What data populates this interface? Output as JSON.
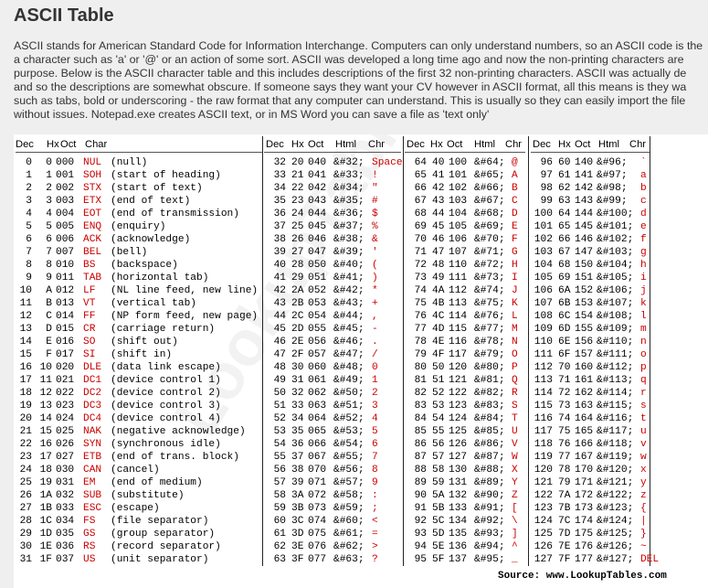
{
  "title": "ASCII Table",
  "intro_lines": [
    "ASCII stands for American Standard Code for Information Interchange. Computers can only understand numbers, so an ASCII code is the",
    "a character such as 'a' or '@' or an action of some sort. ASCII was developed a long time ago and now the non-printing characters are",
    "purpose. Below is the ASCII character table and this includes descriptions of the first 32 non-printing characters. ASCII was actually de",
    "and so the descriptions are somewhat obscure. If someone says they want your CV however in ASCII format, all this means is they wa",
    "such as tabs, bold or underscoring - the raw format that any computer can understand. This is usually so they can easily import the file",
    "without issues. Notepad.exe creates ASCII text, or in MS Word you can save a file as 'text only'"
  ],
  "headers": {
    "block1": [
      "Dec",
      "Hx",
      "Oct",
      "Char"
    ],
    "block2": [
      "Dec",
      "Hx",
      "Oct",
      "Html",
      "Chr"
    ],
    "block3": [
      "Dec",
      "Hx",
      "Oct",
      "Html",
      "Chr"
    ],
    "block4": [
      "Dec",
      "Hx",
      "Oct",
      "Html",
      "Chr"
    ]
  },
  "control_rows": [
    [
      "0",
      "0",
      "000",
      "NUL",
      "(null)"
    ],
    [
      "1",
      "1",
      "001",
      "SOH",
      "(start of heading)"
    ],
    [
      "2",
      "2",
      "002",
      "STX",
      "(start of text)"
    ],
    [
      "3",
      "3",
      "003",
      "ETX",
      "(end of text)"
    ],
    [
      "4",
      "4",
      "004",
      "EOT",
      "(end of transmission)"
    ],
    [
      "5",
      "5",
      "005",
      "ENQ",
      "(enquiry)"
    ],
    [
      "6",
      "6",
      "006",
      "ACK",
      "(acknowledge)"
    ],
    [
      "7",
      "7",
      "007",
      "BEL",
      "(bell)"
    ],
    [
      "8",
      "8",
      "010",
      "BS",
      "(backspace)"
    ],
    [
      "9",
      "9",
      "011",
      "TAB",
      "(horizontal tab)"
    ],
    [
      "10",
      "A",
      "012",
      "LF",
      "(NL line feed, new line)"
    ],
    [
      "11",
      "B",
      "013",
      "VT",
      "(vertical tab)"
    ],
    [
      "12",
      "C",
      "014",
      "FF",
      "(NP form feed, new page)"
    ],
    [
      "13",
      "D",
      "015",
      "CR",
      "(carriage return)"
    ],
    [
      "14",
      "E",
      "016",
      "SO",
      "(shift out)"
    ],
    [
      "15",
      "F",
      "017",
      "SI",
      "(shift in)"
    ],
    [
      "16",
      "10",
      "020",
      "DLE",
      "(data link escape)"
    ],
    [
      "17",
      "11",
      "021",
      "DC1",
      "(device control 1)"
    ],
    [
      "18",
      "12",
      "022",
      "DC2",
      "(device control 2)"
    ],
    [
      "19",
      "13",
      "023",
      "DC3",
      "(device control 3)"
    ],
    [
      "20",
      "14",
      "024",
      "DC4",
      "(device control 4)"
    ],
    [
      "21",
      "15",
      "025",
      "NAK",
      "(negative acknowledge)"
    ],
    [
      "22",
      "16",
      "026",
      "SYN",
      "(synchronous idle)"
    ],
    [
      "23",
      "17",
      "027",
      "ETB",
      "(end of trans. block)"
    ],
    [
      "24",
      "18",
      "030",
      "CAN",
      "(cancel)"
    ],
    [
      "25",
      "19",
      "031",
      "EM",
      "(end of medium)"
    ],
    [
      "26",
      "1A",
      "032",
      "SUB",
      "(substitute)"
    ],
    [
      "27",
      "1B",
      "033",
      "ESC",
      "(escape)"
    ],
    [
      "28",
      "1C",
      "034",
      "FS",
      "(file separator)"
    ],
    [
      "29",
      "1D",
      "035",
      "GS",
      "(group separator)"
    ],
    [
      "30",
      "1E",
      "036",
      "RS",
      "(record separator)"
    ],
    [
      "31",
      "1F",
      "037",
      "US",
      "(unit separator)"
    ]
  ],
  "printable_blocks": [
    [
      [
        "32",
        "20",
        "040",
        "&#32;",
        "Space"
      ],
      [
        "33",
        "21",
        "041",
        "&#33;",
        "!"
      ],
      [
        "34",
        "22",
        "042",
        "&#34;",
        "\""
      ],
      [
        "35",
        "23",
        "043",
        "&#35;",
        "#"
      ],
      [
        "36",
        "24",
        "044",
        "&#36;",
        "$"
      ],
      [
        "37",
        "25",
        "045",
        "&#37;",
        "%"
      ],
      [
        "38",
        "26",
        "046",
        "&#38;",
        "&"
      ],
      [
        "39",
        "27",
        "047",
        "&#39;",
        "'"
      ],
      [
        "40",
        "28",
        "050",
        "&#40;",
        "("
      ],
      [
        "41",
        "29",
        "051",
        "&#41;",
        ")"
      ],
      [
        "42",
        "2A",
        "052",
        "&#42;",
        "*"
      ],
      [
        "43",
        "2B",
        "053",
        "&#43;",
        "+"
      ],
      [
        "44",
        "2C",
        "054",
        "&#44;",
        ","
      ],
      [
        "45",
        "2D",
        "055",
        "&#45;",
        "-"
      ],
      [
        "46",
        "2E",
        "056",
        "&#46;",
        "."
      ],
      [
        "47",
        "2F",
        "057",
        "&#47;",
        "/"
      ],
      [
        "48",
        "30",
        "060",
        "&#48;",
        "0"
      ],
      [
        "49",
        "31",
        "061",
        "&#49;",
        "1"
      ],
      [
        "50",
        "32",
        "062",
        "&#50;",
        "2"
      ],
      [
        "51",
        "33",
        "063",
        "&#51;",
        "3"
      ],
      [
        "52",
        "34",
        "064",
        "&#52;",
        "4"
      ],
      [
        "53",
        "35",
        "065",
        "&#53;",
        "5"
      ],
      [
        "54",
        "36",
        "066",
        "&#54;",
        "6"
      ],
      [
        "55",
        "37",
        "067",
        "&#55;",
        "7"
      ],
      [
        "56",
        "38",
        "070",
        "&#56;",
        "8"
      ],
      [
        "57",
        "39",
        "071",
        "&#57;",
        "9"
      ],
      [
        "58",
        "3A",
        "072",
        "&#58;",
        ":"
      ],
      [
        "59",
        "3B",
        "073",
        "&#59;",
        ";"
      ],
      [
        "60",
        "3C",
        "074",
        "&#60;",
        "<"
      ],
      [
        "61",
        "3D",
        "075",
        "&#61;",
        "="
      ],
      [
        "62",
        "3E",
        "076",
        "&#62;",
        ">"
      ],
      [
        "63",
        "3F",
        "077",
        "&#63;",
        "?"
      ]
    ],
    [
      [
        "64",
        "40",
        "100",
        "&#64;",
        "@"
      ],
      [
        "65",
        "41",
        "101",
        "&#65;",
        "A"
      ],
      [
        "66",
        "42",
        "102",
        "&#66;",
        "B"
      ],
      [
        "67",
        "43",
        "103",
        "&#67;",
        "C"
      ],
      [
        "68",
        "44",
        "104",
        "&#68;",
        "D"
      ],
      [
        "69",
        "45",
        "105",
        "&#69;",
        "E"
      ],
      [
        "70",
        "46",
        "106",
        "&#70;",
        "F"
      ],
      [
        "71",
        "47",
        "107",
        "&#71;",
        "G"
      ],
      [
        "72",
        "48",
        "110",
        "&#72;",
        "H"
      ],
      [
        "73",
        "49",
        "111",
        "&#73;",
        "I"
      ],
      [
        "74",
        "4A",
        "112",
        "&#74;",
        "J"
      ],
      [
        "75",
        "4B",
        "113",
        "&#75;",
        "K"
      ],
      [
        "76",
        "4C",
        "114",
        "&#76;",
        "L"
      ],
      [
        "77",
        "4D",
        "115",
        "&#77;",
        "M"
      ],
      [
        "78",
        "4E",
        "116",
        "&#78;",
        "N"
      ],
      [
        "79",
        "4F",
        "117",
        "&#79;",
        "O"
      ],
      [
        "80",
        "50",
        "120",
        "&#80;",
        "P"
      ],
      [
        "81",
        "51",
        "121",
        "&#81;",
        "Q"
      ],
      [
        "82",
        "52",
        "122",
        "&#82;",
        "R"
      ],
      [
        "83",
        "53",
        "123",
        "&#83;",
        "S"
      ],
      [
        "84",
        "54",
        "124",
        "&#84;",
        "T"
      ],
      [
        "85",
        "55",
        "125",
        "&#85;",
        "U"
      ],
      [
        "86",
        "56",
        "126",
        "&#86;",
        "V"
      ],
      [
        "87",
        "57",
        "127",
        "&#87;",
        "W"
      ],
      [
        "88",
        "58",
        "130",
        "&#88;",
        "X"
      ],
      [
        "89",
        "59",
        "131",
        "&#89;",
        "Y"
      ],
      [
        "90",
        "5A",
        "132",
        "&#90;",
        "Z"
      ],
      [
        "91",
        "5B",
        "133",
        "&#91;",
        "["
      ],
      [
        "92",
        "5C",
        "134",
        "&#92;",
        "\\"
      ],
      [
        "93",
        "5D",
        "135",
        "&#93;",
        "]"
      ],
      [
        "94",
        "5E",
        "136",
        "&#94;",
        "^"
      ],
      [
        "95",
        "5F",
        "137",
        "&#95;",
        "_"
      ]
    ],
    [
      [
        "96",
        "60",
        "140",
        "&#96;",
        "`"
      ],
      [
        "97",
        "61",
        "141",
        "&#97;",
        "a"
      ],
      [
        "98",
        "62",
        "142",
        "&#98;",
        "b"
      ],
      [
        "99",
        "63",
        "143",
        "&#99;",
        "c"
      ],
      [
        "100",
        "64",
        "144",
        "&#100;",
        "d"
      ],
      [
        "101",
        "65",
        "145",
        "&#101;",
        "e"
      ],
      [
        "102",
        "66",
        "146",
        "&#102;",
        "f"
      ],
      [
        "103",
        "67",
        "147",
        "&#103;",
        "g"
      ],
      [
        "104",
        "68",
        "150",
        "&#104;",
        "h"
      ],
      [
        "105",
        "69",
        "151",
        "&#105;",
        "i"
      ],
      [
        "106",
        "6A",
        "152",
        "&#106;",
        "j"
      ],
      [
        "107",
        "6B",
        "153",
        "&#107;",
        "k"
      ],
      [
        "108",
        "6C",
        "154",
        "&#108;",
        "l"
      ],
      [
        "109",
        "6D",
        "155",
        "&#109;",
        "m"
      ],
      [
        "110",
        "6E",
        "156",
        "&#110;",
        "n"
      ],
      [
        "111",
        "6F",
        "157",
        "&#111;",
        "o"
      ],
      [
        "112",
        "70",
        "160",
        "&#112;",
        "p"
      ],
      [
        "113",
        "71",
        "161",
        "&#113;",
        "q"
      ],
      [
        "114",
        "72",
        "162",
        "&#114;",
        "r"
      ],
      [
        "115",
        "73",
        "163",
        "&#115;",
        "s"
      ],
      [
        "116",
        "74",
        "164",
        "&#116;",
        "t"
      ],
      [
        "117",
        "75",
        "165",
        "&#117;",
        "u"
      ],
      [
        "118",
        "76",
        "166",
        "&#118;",
        "v"
      ],
      [
        "119",
        "77",
        "167",
        "&#119;",
        "w"
      ],
      [
        "120",
        "78",
        "170",
        "&#120;",
        "x"
      ],
      [
        "121",
        "79",
        "171",
        "&#121;",
        "y"
      ],
      [
        "122",
        "7A",
        "172",
        "&#122;",
        "z"
      ],
      [
        "123",
        "7B",
        "173",
        "&#123;",
        "{"
      ],
      [
        "124",
        "7C",
        "174",
        "&#124;",
        "|"
      ],
      [
        "125",
        "7D",
        "175",
        "&#125;",
        "}"
      ],
      [
        "126",
        "7E",
        "176",
        "&#126;",
        "~"
      ],
      [
        "127",
        "7F",
        "177",
        "&#127;",
        "DEL"
      ]
    ]
  ],
  "watermark": "LookupTables.com",
  "source": "Source:  www.LookupTables.com",
  "colors": {
    "highlight": "#cc0000",
    "page_bg": "#efefef",
    "table_bg": "#ffffff"
  }
}
